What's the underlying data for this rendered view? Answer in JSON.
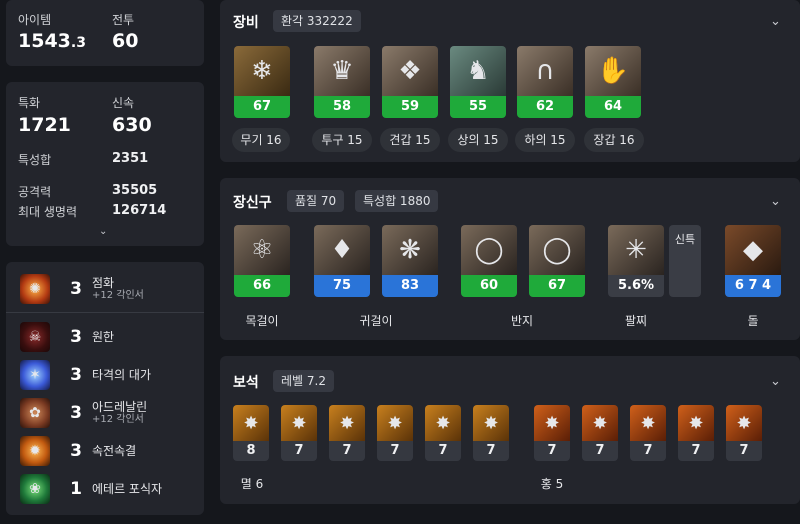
{
  "stats_top": {
    "item_label": "아이템",
    "item_value_main": "1543",
    "item_value_dec": ".3",
    "combat_label": "전투",
    "combat_value": "60"
  },
  "stats": {
    "crit_label": "특화",
    "crit_value": "1721",
    "swift_label": "신속",
    "swift_value": "630",
    "trait_total_label": "특성합",
    "trait_total_value": "2351",
    "attack_label": "공격력",
    "attack_value": "35505",
    "hp_label": "최대 생명력",
    "hp_value": "126714"
  },
  "engravings": [
    {
      "level": "3",
      "name": "점화",
      "sub": "+12 각인서"
    },
    {
      "level": "3",
      "name": "원한",
      "sub": ""
    },
    {
      "level": "3",
      "name": "타격의 대가",
      "sub": ""
    },
    {
      "level": "3",
      "name": "아드레날린",
      "sub": "+12 각인서"
    },
    {
      "level": "3",
      "name": "속전속결",
      "sub": ""
    },
    {
      "level": "1",
      "name": "에테르 포식자",
      "sub": ""
    }
  ],
  "equipment": {
    "title": "장비",
    "chip": "환각 332222",
    "items": [
      {
        "quality": "67",
        "label": "무기 16"
      },
      {
        "quality": "58",
        "label": "투구 15"
      },
      {
        "quality": "59",
        "label": "견갑 15"
      },
      {
        "quality": "55",
        "label": "상의 15"
      },
      {
        "quality": "62",
        "label": "하의 15"
      },
      {
        "quality": "64",
        "label": "장갑 16"
      }
    ]
  },
  "accessories": {
    "title": "장신구",
    "chip_quality": "품질 70",
    "chip_trait": "특성합 1880",
    "items": [
      {
        "quality": "66"
      },
      {
        "quality": "75"
      },
      {
        "quality": "83"
      },
      {
        "quality": "60"
      },
      {
        "quality": "67"
      }
    ],
    "bracelet_value": "5.6%",
    "bracelet_stat": "신특",
    "stone_value": "6 7 4",
    "labels": {
      "necklace": "목걸이",
      "earring": "귀걸이",
      "ring": "반지",
      "bracelet": "팔찌",
      "stone": "돌"
    }
  },
  "gems": {
    "title": "보석",
    "chip": "레벨 7.2",
    "left_levels": [
      "8",
      "7",
      "7",
      "7",
      "7",
      "7"
    ],
    "right_levels": [
      "7",
      "7",
      "7",
      "7",
      "7"
    ],
    "left_label": "멸 6",
    "right_label": "홍 5"
  },
  "colors": {
    "green": "#1faa3a",
    "blue": "#2a74d8",
    "gray": "#3a3d45"
  }
}
